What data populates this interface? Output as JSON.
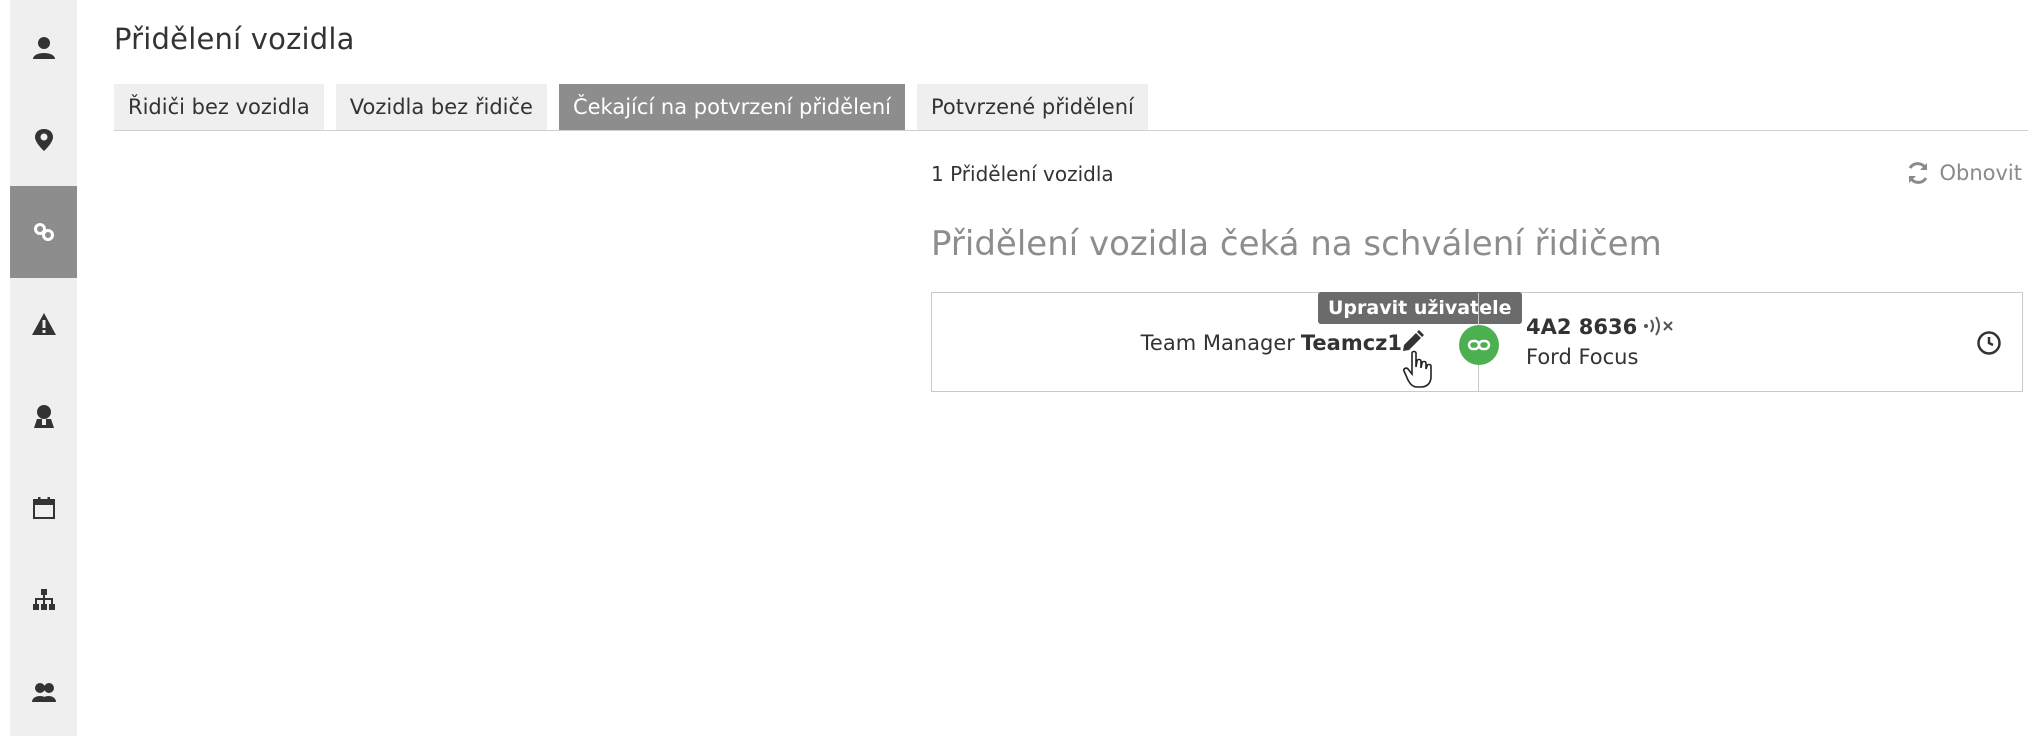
{
  "sidebar": {
    "items": [
      {
        "icon": "person-icon",
        "active": false
      },
      {
        "icon": "location-pin-icon",
        "active": false
      },
      {
        "icon": "link-icon",
        "active": true
      },
      {
        "icon": "warning-icon",
        "active": false
      },
      {
        "icon": "driver-icon",
        "active": false
      },
      {
        "icon": "calendar-icon",
        "active": false
      },
      {
        "icon": "hierarchy-icon",
        "active": false
      },
      {
        "icon": "group-icon",
        "active": false
      }
    ]
  },
  "page": {
    "title": "Přidělení vozidla"
  },
  "tabs": [
    {
      "label": "Řidiči bez vozidla",
      "active": false
    },
    {
      "label": "Vozidla bez řidiče",
      "active": false
    },
    {
      "label": "Čekající na potvrzení přidělení",
      "active": true
    },
    {
      "label": "Potvrzené přidělení",
      "active": false
    }
  ],
  "toolbar": {
    "count_text": "1 Přidělení vozidla",
    "refresh_label": "Obnovit"
  },
  "section": {
    "title": "Přidělení vozidla čeká na schválení řidičem"
  },
  "assignment": {
    "driver_role": "Team Manager",
    "driver_name": "Teamcz1",
    "tooltip": "Upravit uživatele",
    "plate": "4A2 8636",
    "model": "Ford Focus"
  },
  "colors": {
    "active_tab": "#8d8d8d",
    "link_badge": "#4caf50",
    "sidebar_bg": "#efefef"
  }
}
